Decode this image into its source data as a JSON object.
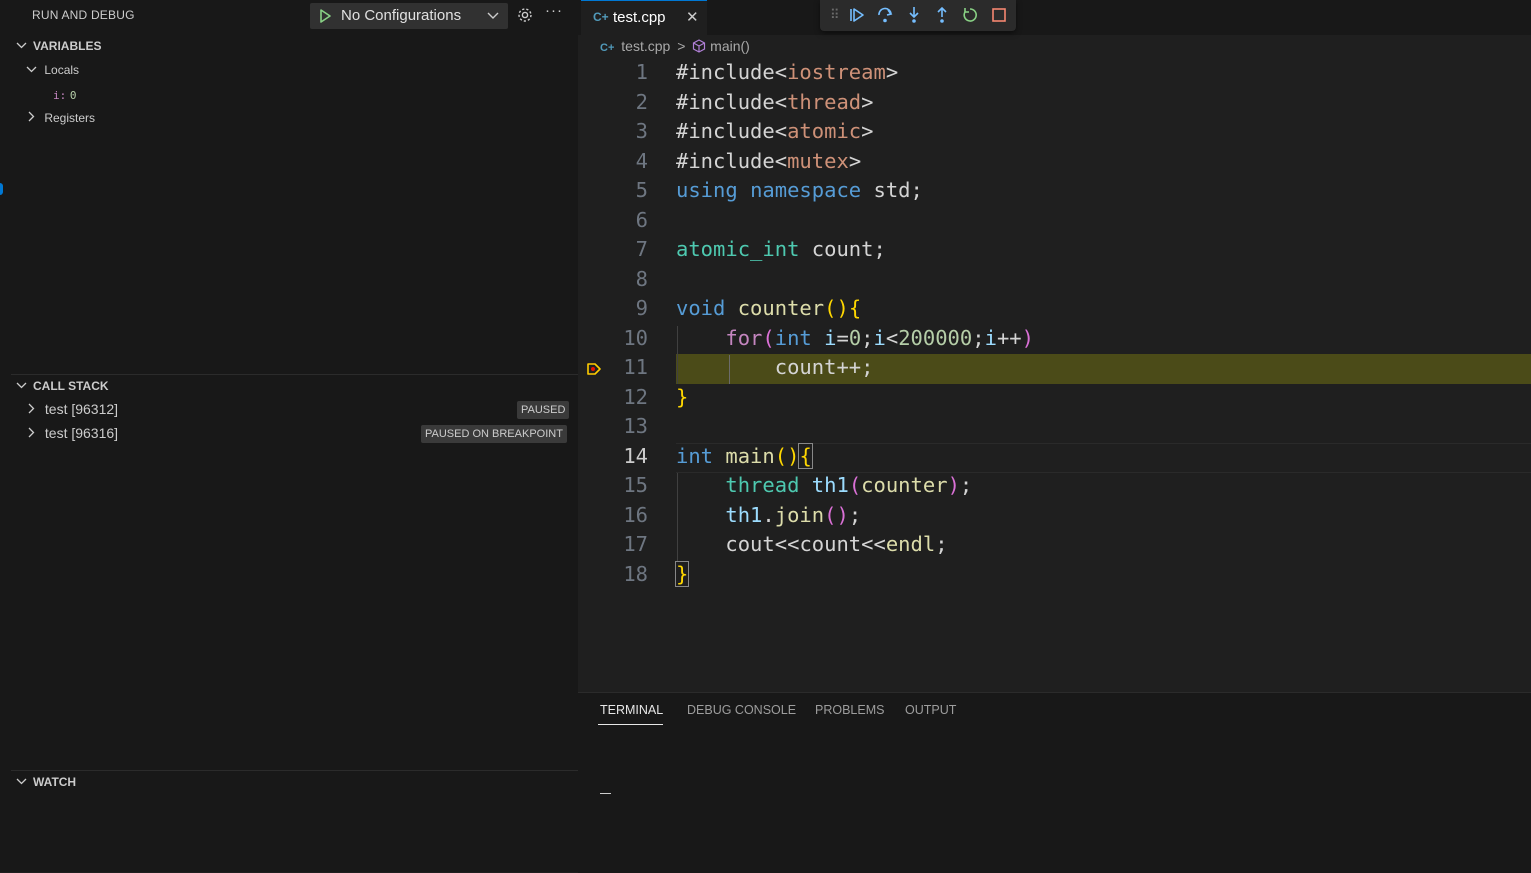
{
  "sidebar": {
    "title": "RUN AND DEBUG",
    "config_label": "No Configurations",
    "variables": {
      "header": "VARIABLES",
      "locals_label": "Locals",
      "local_var_name": "i:",
      "local_var_value": "0",
      "registers_label": "Registers"
    },
    "call_stack": {
      "header": "CALL STACK",
      "threads": [
        {
          "label": "test [96312]",
          "status": "PAUSED"
        },
        {
          "label": "test [96316]",
          "status": "PAUSED ON BREAKPOINT"
        }
      ]
    },
    "watch": {
      "header": "WATCH"
    }
  },
  "editor": {
    "tab_label": "test.cpp",
    "breadcrumb": {
      "file": "test.cpp",
      "sep": ">",
      "symbol": "main()"
    },
    "current_line": 11,
    "line_numbers": [
      "1",
      "2",
      "3",
      "4",
      "5",
      "6",
      "7",
      "8",
      "9",
      "10",
      "11",
      "12",
      "13",
      "14",
      "15",
      "16",
      "17",
      "18"
    ]
  },
  "code_tokens": {
    "l1": [
      "#include",
      "<",
      "iostream",
      ">"
    ],
    "l2": [
      "#include",
      "<",
      "thread",
      ">"
    ],
    "l3": [
      "#include",
      "<",
      "atomic",
      ">"
    ],
    "l4": [
      "#include",
      "<",
      "mutex",
      ">"
    ],
    "l5": [
      "using",
      " ",
      "namespace",
      " std;"
    ],
    "l7": [
      "atomic_int",
      " count;"
    ],
    "l9": [
      "void",
      " ",
      "counter",
      "()",
      "{"
    ],
    "l10": [
      "    ",
      "for",
      "(",
      "int",
      " ",
      "i",
      "=",
      "0",
      ";",
      "i",
      "<",
      "200000",
      ";",
      "i",
      "++",
      ")"
    ],
    "l11": [
      "        ",
      "count",
      "++;"
    ],
    "l12": [
      "}"
    ],
    "l14": [
      "int",
      " ",
      "main",
      "()",
      "{"
    ],
    "l15": [
      "    ",
      "thread",
      " ",
      "th1",
      "(",
      "counter",
      ")",
      ";"
    ],
    "l16": [
      "    ",
      "th1",
      ".",
      "join",
      "()",
      ";"
    ],
    "l17": [
      "    ",
      "cout",
      "<<",
      "count",
      "<<",
      "endl",
      ";"
    ],
    "l18": [
      "}"
    ]
  },
  "panel": {
    "tabs": [
      "TERMINAL",
      "DEBUG CONSOLE",
      "PROBLEMS",
      "OUTPUT"
    ],
    "active_tab": "TERMINAL"
  },
  "icons": {
    "debug_toolbar": [
      "grip-icon",
      "continue-icon",
      "step-over-icon",
      "step-into-icon",
      "step-out-icon",
      "restart-icon",
      "stop-icon"
    ]
  },
  "colors": {
    "accent": "#0078d4",
    "breakpoint_highlight": "#4b4b18",
    "debug_icon": "#75beff",
    "restart_icon": "#89d185",
    "stop_icon": "#f48771"
  }
}
